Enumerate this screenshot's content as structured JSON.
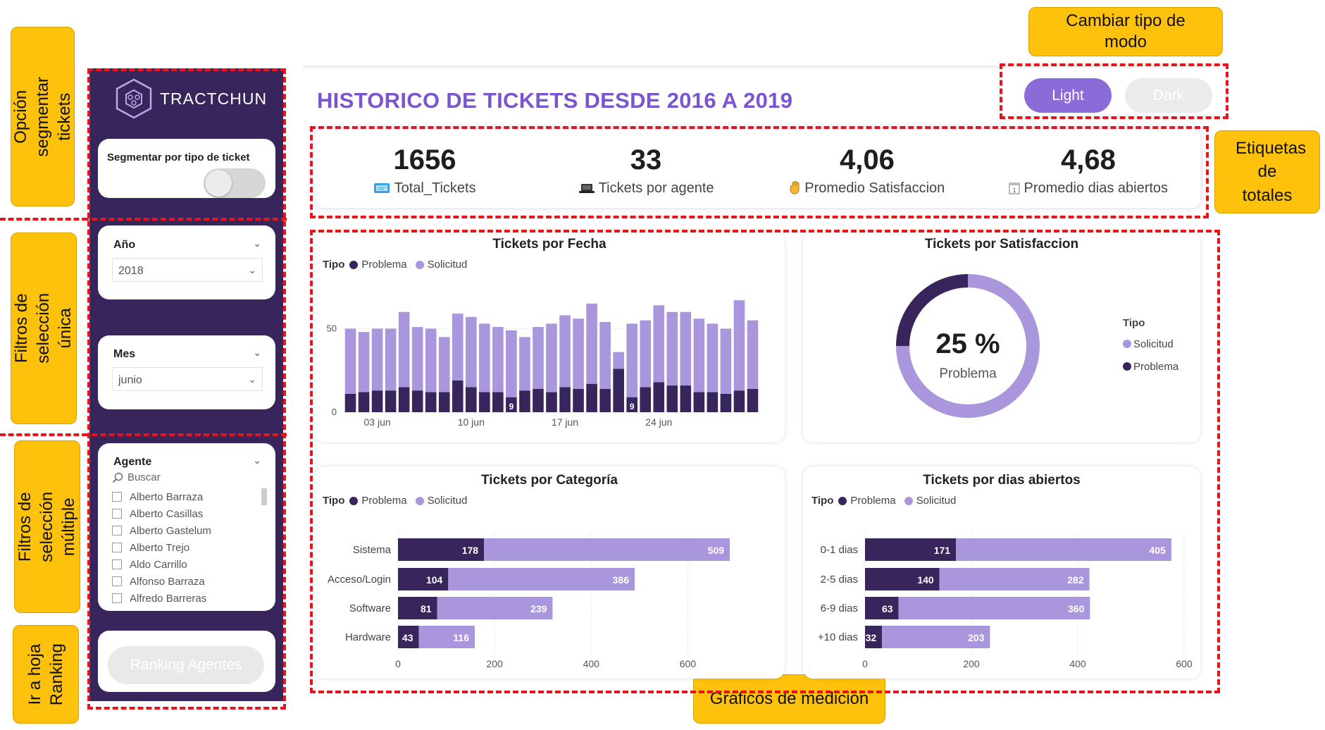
{
  "annotations": {
    "mode": "Cambiar tipo de modo",
    "segment": "Opción segmentar tickets",
    "single": "Filtros de selección única",
    "multi": "Filtros de selección múltiple",
    "ranking": "Ir a hoja Ranking",
    "totals": "Etiquetas de totales",
    "charts": "Gráficos de medición"
  },
  "sidebar": {
    "brand": "TRACTCHUN",
    "segment_label": "Segmentar por tipo de ticket",
    "segment_toggle_on": false,
    "year": {
      "label": "Año",
      "value": "2018"
    },
    "month": {
      "label": "Mes",
      "value": "junio"
    },
    "agent": {
      "label": "Agente",
      "search_placeholder": "Buscar",
      "items": [
        "Alberto Barraza",
        "Alberto Casillas",
        "Alberto Gastelum",
        "Alberto Trejo",
        "Aldo Carrillo",
        "Alfonso Barraza",
        "Alfredo Barreras"
      ]
    },
    "ranking_button": "Ranking Agentes"
  },
  "header": {
    "title": "HISTORICO DE TICKETS DESDE 2016 A 2019",
    "light_button": "Light",
    "dark_button": "Dark"
  },
  "kpis": [
    {
      "value": "1656",
      "label": "Total_Tickets",
      "icon": "ticket-icon"
    },
    {
      "value": "33",
      "label": "Tickets por agente",
      "icon": "laptop-icon"
    },
    {
      "value": "4,06",
      "label": "Promedio Satisfaccion",
      "icon": "hand-icon"
    },
    {
      "value": "4,68",
      "label": "Promedio dias abiertos",
      "icon": "calendar-icon"
    }
  ],
  "colors": {
    "problema": "#37255c",
    "solicitud": "#a996dc",
    "accent": "#7b55cf",
    "sidebar": "#37255c"
  },
  "legend": {
    "tipo": "Tipo",
    "problema": "Problema",
    "solicitud": "Solicitud"
  },
  "chart_data": [
    {
      "type": "bar",
      "stacked": true,
      "title": "Tickets por Fecha",
      "x": [
        "01 jun",
        "02 jun",
        "03 jun",
        "04 jun",
        "05 jun",
        "06 jun",
        "07 jun",
        "08 jun",
        "09 jun",
        "10 jun",
        "11 jun",
        "12 jun",
        "13 jun",
        "14 jun",
        "15 jun",
        "16 jun",
        "17 jun",
        "18 jun",
        "19 jun",
        "20 jun",
        "21 jun",
        "22 jun",
        "23 jun",
        "24 jun",
        "25 jun",
        "26 jun",
        "27 jun",
        "28 jun",
        "29 jun",
        "30 jun"
      ],
      "tick_labels": [
        "03 jun",
        "10 jun",
        "17 jun",
        "24 jun"
      ],
      "series": [
        {
          "name": "Problema",
          "values": [
            11,
            12,
            13,
            13,
            15,
            13,
            12,
            12,
            19,
            15,
            12,
            12,
            9,
            13,
            14,
            12,
            15,
            14,
            17,
            14,
            26,
            9,
            15,
            18,
            16,
            16,
            12,
            12,
            11,
            13,
            14
          ]
        },
        {
          "name": "Solicitud",
          "values": [
            39,
            36,
            37,
            37,
            45,
            38,
            38,
            33,
            40,
            42,
            41,
            39,
            40,
            32,
            37,
            41,
            43,
            42,
            48,
            40,
            10,
            44,
            40,
            46,
            44,
            44,
            44,
            41,
            39,
            54,
            41
          ]
        }
      ],
      "data_labels": [
        {
          "x": "13 jun",
          "series": "Problema",
          "value": 9
        },
        {
          "x": "22 jun",
          "series": "Problema",
          "value": 9
        }
      ],
      "yticks": [
        0,
        50
      ],
      "ylim": [
        0,
        70
      ]
    },
    {
      "type": "pie",
      "donut": true,
      "title": "Tickets por Satisfaccion",
      "center_value": "25 %",
      "center_label": "Problema",
      "legend_title": "Tipo",
      "categories": [
        "Solicitud",
        "Problema"
      ],
      "values": [
        75,
        25
      ]
    },
    {
      "type": "bar",
      "orientation": "horizontal",
      "stacked": true,
      "title": "Tickets por Categoría",
      "categories": [
        "Sistema",
        "Acceso/Login",
        "Software",
        "Hardware"
      ],
      "series": [
        {
          "name": "Problema",
          "values": [
            178,
            104,
            81,
            43
          ]
        },
        {
          "name": "Solicitud",
          "values": [
            509,
            386,
            239,
            116
          ]
        }
      ],
      "xticks": [
        0,
        200,
        400,
        600
      ],
      "xlim": [
        0,
        700
      ]
    },
    {
      "type": "bar",
      "orientation": "horizontal",
      "stacked": true,
      "title": "Tickets por dias abiertos",
      "categories": [
        "0-1 dias",
        "2-5 dias",
        "6-9 dias",
        "+10 dias"
      ],
      "series": [
        {
          "name": "Problema",
          "values": [
            171,
            140,
            63,
            32
          ]
        },
        {
          "name": "Solicitud",
          "values": [
            405,
            282,
            360,
            203
          ]
        }
      ],
      "xticks": [
        0,
        200,
        400,
        600
      ],
      "xlim": [
        0,
        600
      ]
    }
  ]
}
